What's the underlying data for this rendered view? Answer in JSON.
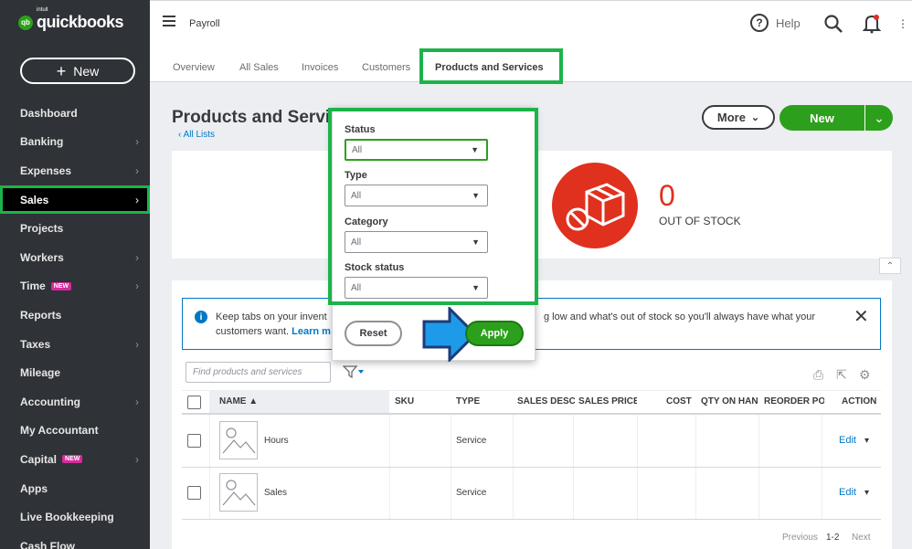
{
  "brand": {
    "intuit": "intuit",
    "badge": "qb",
    "name": "quickbooks"
  },
  "sidebar": {
    "new_label": "New",
    "items": [
      {
        "label": "Dashboard",
        "chevron": false,
        "badge": ""
      },
      {
        "label": "Banking",
        "chevron": true,
        "badge": ""
      },
      {
        "label": "Expenses",
        "chevron": true,
        "badge": ""
      },
      {
        "label": "Sales",
        "chevron": true,
        "badge": "",
        "active": true
      },
      {
        "label": "Projects",
        "chevron": false,
        "badge": ""
      },
      {
        "label": "Workers",
        "chevron": true,
        "badge": ""
      },
      {
        "label": "Time",
        "chevron": true,
        "badge": "NEW"
      },
      {
        "label": "Reports",
        "chevron": false,
        "badge": ""
      },
      {
        "label": "Taxes",
        "chevron": true,
        "badge": ""
      },
      {
        "label": "Mileage",
        "chevron": false,
        "badge": ""
      },
      {
        "label": "Accounting",
        "chevron": true,
        "badge": ""
      },
      {
        "label": "My Accountant",
        "chevron": false,
        "badge": ""
      },
      {
        "label": "Capital",
        "chevron": true,
        "badge": "NEW"
      },
      {
        "label": "Apps",
        "chevron": false,
        "badge": ""
      },
      {
        "label": "Live Bookkeeping",
        "chevron": false,
        "badge": ""
      },
      {
        "label": "Cash Flow",
        "chevron": false,
        "badge": ""
      }
    ],
    "chevron_glyph": "›"
  },
  "topbar": {
    "page": "Payroll",
    "help": "Help",
    "help_glyph": "?"
  },
  "tabs": [
    "Overview",
    "All Sales",
    "Invoices",
    "Customers",
    "Products and Services"
  ],
  "page": {
    "title": "Products and Servi",
    "all_lists": "All Lists",
    "more": "More",
    "new": "New",
    "stock_count": "0",
    "stock_label": "OUT OF STOCK"
  },
  "banner": {
    "line1": "Keep tabs on your invent",
    "line2": "customers want.",
    "learn": "Learn m",
    "line1_tail": "g low and what's out of stock so you'll always have what your"
  },
  "table": {
    "search_placeholder": "Find products and services",
    "headers": [
      "NAME ▲",
      "SKU",
      "TYPE",
      "SALES DESCR",
      "SALES PRICE",
      "COST",
      "QTY ON HAN",
      "REORDER PO",
      "ACTION"
    ],
    "rows": [
      {
        "name": "Hours",
        "type": "Service",
        "action": "Edit"
      },
      {
        "name": "Sales",
        "type": "Service",
        "action": "Edit"
      }
    ],
    "pager": {
      "previous": "Previous",
      "range": "1-2",
      "next": "Next"
    }
  },
  "filter": {
    "fields": [
      {
        "label": "Status",
        "value": "All"
      },
      {
        "label": "Type",
        "value": "All"
      },
      {
        "label": "Category",
        "value": "All"
      },
      {
        "label": "Stock status",
        "value": "All"
      }
    ],
    "reset": "Reset",
    "apply": "Apply"
  },
  "colors": {
    "accent": "#2ca01c",
    "highlight": "#1db34a",
    "sidebar": "#2f3237",
    "alert": "#e0301e",
    "link": "#0077c5"
  }
}
